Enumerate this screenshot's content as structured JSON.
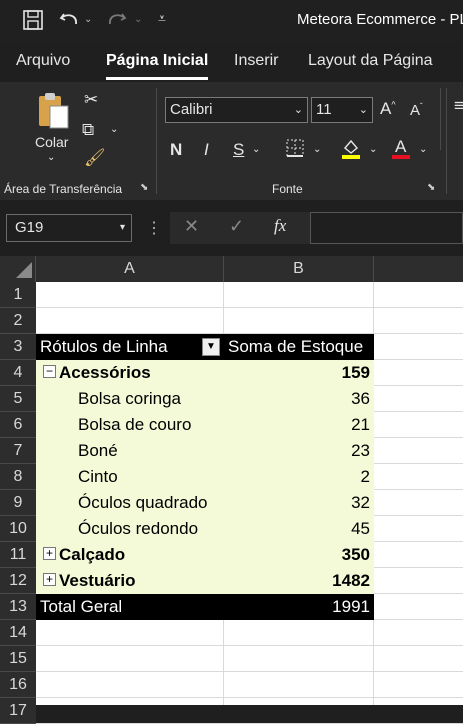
{
  "window": {
    "title": "Meteora Ecommerce - PL"
  },
  "ribbon": {
    "tabs": [
      "Arquivo",
      "Página Inicial",
      "Inserir",
      "Layout da Página"
    ],
    "clipboard": {
      "paste_label": "Colar",
      "group_label": "Área de Transferência"
    },
    "font": {
      "font_name": "Calibri",
      "font_size": "11",
      "group_label": "Fonte"
    }
  },
  "formula": {
    "name_box": "G19",
    "fx": "fx"
  },
  "sheet": {
    "columns": [
      "A",
      "B"
    ],
    "rows": [
      "1",
      "2",
      "3",
      "4",
      "5",
      "6",
      "7",
      "8",
      "9",
      "10",
      "11",
      "12",
      "13",
      "14",
      "15",
      "16",
      "17"
    ],
    "pivot": {
      "header_label": "Rótulos de Linha",
      "header_value": "Soma de Estoque",
      "groups": [
        {
          "label": "Acessórios",
          "value": "159",
          "expanded": true,
          "items": [
            {
              "label": "Bolsa coringa",
              "value": "36"
            },
            {
              "label": "Bolsa de couro",
              "value": "21"
            },
            {
              "label": "Boné",
              "value": "23"
            },
            {
              "label": "Cinto",
              "value": "2"
            },
            {
              "label": "Óculos quadrado",
              "value": "32"
            },
            {
              "label": "Óculos redondo",
              "value": "45"
            }
          ]
        },
        {
          "label": "Calçado",
          "value": "350",
          "expanded": false
        },
        {
          "label": "Vestuário",
          "value": "1482",
          "expanded": false
        }
      ],
      "total_label": "Total Geral",
      "total_value": "1991"
    }
  }
}
